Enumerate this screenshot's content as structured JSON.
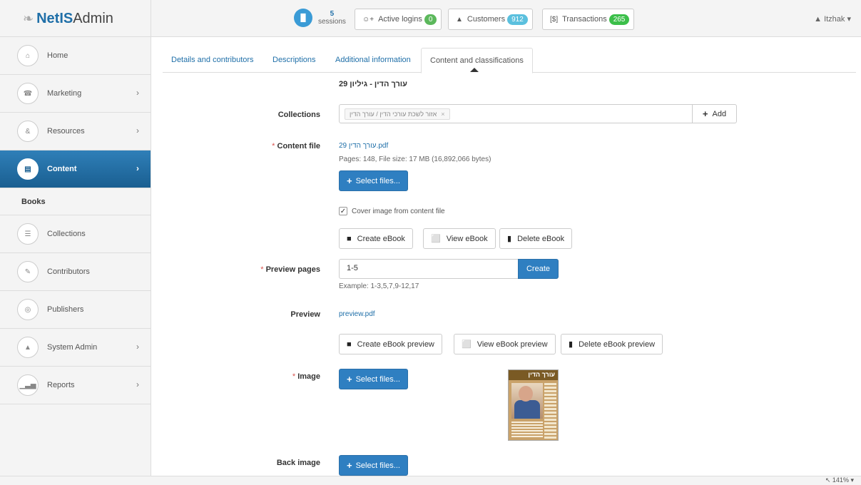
{
  "app": {
    "logo_brand": "NetIS",
    "logo_suffix": "Admin"
  },
  "topbar": {
    "sessions_count": "5",
    "sessions_label": "sessions",
    "active_logins_label": "Active logins",
    "active_logins_count": "0",
    "customers_label": "Customers",
    "customers_count": "912",
    "transactions_label": "Transactions",
    "transactions_count": "265",
    "user": "Itzhak ▾"
  },
  "sidebar": {
    "items": [
      {
        "label": "Home"
      },
      {
        "label": "Marketing"
      },
      {
        "label": "Resources"
      },
      {
        "label": "Content"
      },
      {
        "label": "Collections"
      },
      {
        "label": "Contributors"
      },
      {
        "label": "Publishers"
      },
      {
        "label": "System Admin"
      },
      {
        "label": "Reports"
      }
    ],
    "sub_item": "Books"
  },
  "tabs": [
    {
      "label": "Details and contributors"
    },
    {
      "label": "Descriptions"
    },
    {
      "label": "Additional information"
    },
    {
      "label": "Content and classifications"
    }
  ],
  "form": {
    "book_title": "עורך הדין - גיליון 29",
    "collections_label": "Collections",
    "collection_chip": "אזור לשכת עורכי הדין / עורך הדין",
    "add_label": "Add",
    "content_file_label": "Content file",
    "content_file_name": "עורך הדין 29.pdf",
    "content_file_info": "Pages: 148, File size: 17 MB (16,892,066 bytes)",
    "select_files_label": "Select files...",
    "cover_checkbox_label": "Cover image from content file",
    "create_ebook": "Create eBook",
    "view_ebook": "View eBook",
    "delete_ebook": "Delete eBook",
    "preview_pages_label": "Preview pages",
    "preview_pages_value": "1-5",
    "create_label": "Create",
    "preview_example": "Example: 1-3,5,7,9-12,17",
    "preview_label": "Preview",
    "preview_file": "preview.pdf",
    "create_ebook_preview": "Create eBook preview",
    "view_ebook_preview": "View eBook preview",
    "delete_ebook_preview": "Delete eBook preview",
    "image_label": "Image",
    "back_image_label": "Back image",
    "cover_masthead": "עורך הדין"
  },
  "status": {
    "zoom": "141%"
  }
}
